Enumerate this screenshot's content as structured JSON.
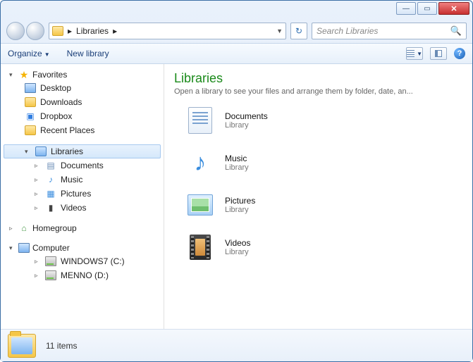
{
  "titlebar": {
    "min": "—",
    "max": "▭",
    "close": "✕"
  },
  "address": {
    "path": "Libraries",
    "sep": "▸"
  },
  "search": {
    "placeholder": "Search Libraries"
  },
  "toolbar": {
    "organize": "Organize",
    "newlib": "New library"
  },
  "sidebar": {
    "favorites": {
      "label": "Favorites",
      "items": [
        "Desktop",
        "Downloads",
        "Dropbox",
        "Recent Places"
      ]
    },
    "libraries": {
      "label": "Libraries",
      "items": [
        "Documents",
        "Music",
        "Pictures",
        "Videos"
      ]
    },
    "homegroup": {
      "label": "Homegroup"
    },
    "computer": {
      "label": "Computer",
      "items": [
        "WINDOWS7 (C:)",
        "MENNO (D:)"
      ]
    }
  },
  "content": {
    "title": "Libraries",
    "subtitle": "Open a library to see your files and arrange them by folder, date, an...",
    "type_label": "Library",
    "items": [
      "Documents",
      "Music",
      "Pictures",
      "Videos"
    ]
  },
  "status": {
    "count": "11 items"
  }
}
